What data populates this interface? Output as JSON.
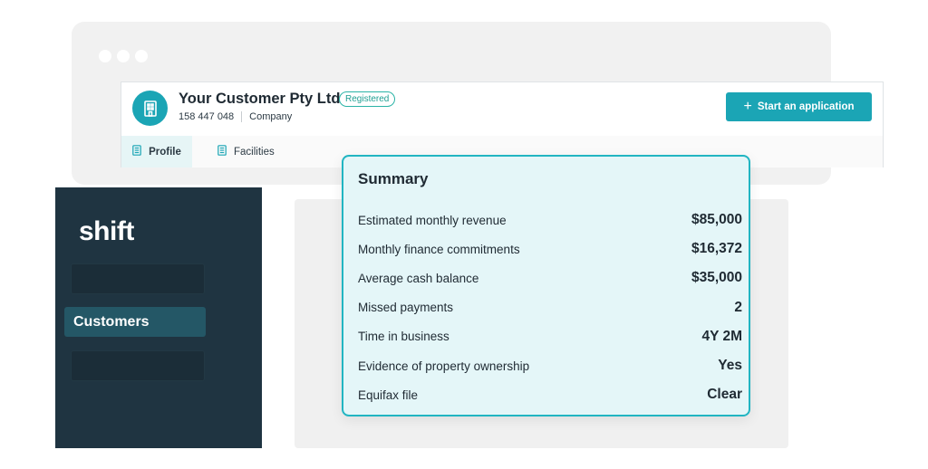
{
  "browser": {
    "icons": [
      "window-dot-icon",
      "window-dot-icon",
      "window-dot-icon"
    ]
  },
  "customer": {
    "name": "Your Customer Pty Ltd",
    "status_badge": "Registered",
    "abn": "158 447 048",
    "entity_type": "Company",
    "start_button_label": "Start an application",
    "tabs": [
      {
        "label": "Profile",
        "icon": "document-icon",
        "active": true
      },
      {
        "label": "Facilities",
        "icon": "document-icon",
        "active": false
      }
    ]
  },
  "sidebar": {
    "logo": "shift",
    "items": [
      {
        "label": ""
      },
      {
        "label": "Customers",
        "active": true
      },
      {
        "label": ""
      }
    ]
  },
  "summary": {
    "title": "Summary",
    "rows": [
      {
        "label": "Estimated monthly revenue",
        "value": "$85,000"
      },
      {
        "label": "Monthly finance commitments",
        "value": "$16,372"
      },
      {
        "label": "Average cash balance",
        "value": "$35,000"
      },
      {
        "label": "Missed payments",
        "value": "2"
      },
      {
        "label": "Time in business",
        "value": "4Y 2M"
      },
      {
        "label": "Evidence of property ownership",
        "value": "Yes"
      },
      {
        "label": "Equifax file",
        "value": "Clear"
      }
    ]
  },
  "colors": {
    "accent": "#1ba5b5",
    "sidebar_bg": "#1f3441",
    "sidebar_active": "#245766",
    "summary_bg": "#e4f6f8",
    "registered_badge": "#2bb3a6"
  }
}
